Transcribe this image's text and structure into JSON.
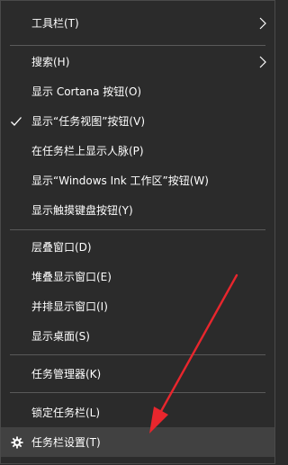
{
  "menu": {
    "items": [
      {
        "label": "工具栏(T)"
      },
      {
        "label": "搜索(H)"
      },
      {
        "label": "显示 Cortana 按钮(O)"
      },
      {
        "label": "显示“任务视图”按钮(V)"
      },
      {
        "label": "在任务栏上显示人脉(P)"
      },
      {
        "label": "显示“Windows Ink 工作区”按钮(W)"
      },
      {
        "label": "显示触摸键盘按钮(Y)"
      },
      {
        "label": "层叠窗口(D)"
      },
      {
        "label": "堆叠显示窗口(E)"
      },
      {
        "label": "并排显示窗口(I)"
      },
      {
        "label": "显示桌面(S)"
      },
      {
        "label": "任务管理器(K)"
      },
      {
        "label": "锁定任务栏(L)"
      },
      {
        "label": "任务栏设置(T)"
      }
    ],
    "checked_item": "显示“任务视图”按钮(V)",
    "highlighted_item": "任务栏设置(T)"
  },
  "icons": {
    "submenu": "chevron-right-icon",
    "checked": "checkmark-icon",
    "settings": "gear-icon",
    "annotation": "red-arrow-annotation"
  },
  "colors": {
    "menu_background": "#2b2b2b",
    "hover_background": "#414141",
    "text": "#ffffff",
    "separator": "#5a5a5a",
    "annotation_arrow": "#e8262d"
  }
}
